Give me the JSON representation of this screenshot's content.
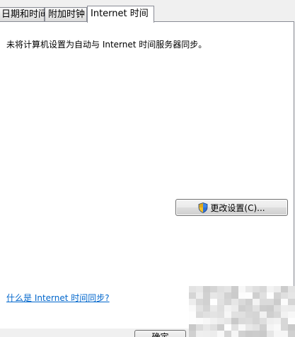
{
  "tabs": [
    {
      "label": "日期和时间",
      "active": false
    },
    {
      "label": "附加时钟",
      "active": false
    },
    {
      "label": "Internet 时间",
      "active": true
    }
  ],
  "panel": {
    "status_text": "未将计算机设置为自动与 Internet 时间服务器同步。",
    "change_settings_label": "更改设置(C)...",
    "help_link": "什么是 Internet 时间同步?"
  },
  "footer": {
    "ok_label": "确定"
  },
  "icons": {
    "change_settings_icon": "uac-shield-icon"
  }
}
